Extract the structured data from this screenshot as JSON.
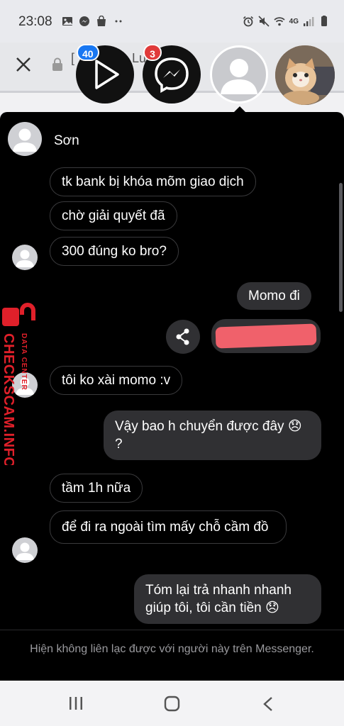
{
  "status_bar": {
    "time": "23:08",
    "network_label": "4G",
    "left_icons": [
      "gallery-icon",
      "messenger-icon",
      "shopping-bag-icon",
      "more-dots-icon"
    ],
    "right_icons": [
      "alarm-icon",
      "mute-icon",
      "wifi-icon",
      "cellular-signal-icon",
      "battery-icon"
    ]
  },
  "background_page": {
    "title_fragment_a": "[",
    "title_fragment_b": "Lu",
    "close_icon": "close-icon",
    "lock_icon": "lock-icon"
  },
  "chat_heads": {
    "play_badge": "40",
    "messenger_badge": "3"
  },
  "chat": {
    "contact_name": "Sơn",
    "messages": [
      {
        "from": "them",
        "text": "tk bank bị khóa mõm giao dịch"
      },
      {
        "from": "them",
        "text": "chờ giải quyết đã"
      },
      {
        "from": "them",
        "text": "300 đúng ko bro?"
      },
      {
        "from": "me",
        "text": "Momo đi"
      },
      {
        "from": "me",
        "text": ""
      },
      {
        "from": "them",
        "text": "tôi ko xài momo :v"
      },
      {
        "from": "me",
        "text": "Vậy bao h chuyển được đây 😞 ?"
      },
      {
        "from": "them",
        "text": "tầm 1h nữa"
      },
      {
        "from": "them",
        "text": "để đi ra ngoài tìm mấy chỗ cầm đồ"
      },
      {
        "from": "me",
        "text": "Tóm lại trả nhanh nhanh giúp tôi, tôi cần tiền 😞"
      }
    ],
    "footer_notice": "Hiện không liên lạc được với người này trên Messenger."
  },
  "watermark": {
    "brand": "CHECKSCAM.INFO",
    "tagline": "DATA CENTER"
  },
  "colors": {
    "panel_bg": "#000000",
    "outgoing_bubble": "#303033",
    "incoming_border": "#3a3a3c",
    "watermark_red": "#e0202a",
    "redaction_red": "#f0616b",
    "badge_blue": "#1877f2",
    "badge_red": "#e03a3a"
  },
  "nav_bar": {
    "icons": [
      "recent-apps-icon",
      "home-icon",
      "back-icon"
    ]
  }
}
